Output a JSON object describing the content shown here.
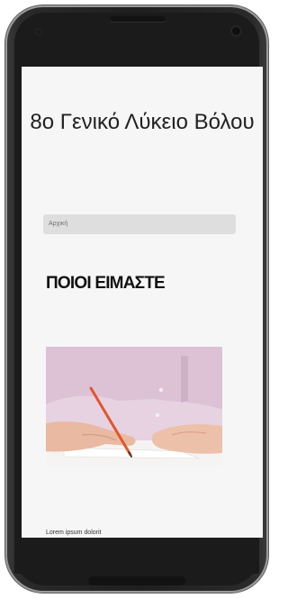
{
  "page": {
    "title": "8o Γενικό Λύκειο Βόλου",
    "nav_label": "Αρχική",
    "section_title": "ΠΟΙΟΙ ΕΙΜΑΣΤΕ",
    "lorem_text": "Lorem ipsum dolorit"
  },
  "colors": {
    "device_body": "#1f1f1f",
    "screen_background": "#f6f6f6",
    "nav_bar": "#dedede",
    "photo_shirt": "#e3c9dd",
    "pencil": "#e2552d"
  },
  "icons": [
    "front-camera-icon",
    "proximity-sensor-icon",
    "speaker-grille-icon"
  ]
}
